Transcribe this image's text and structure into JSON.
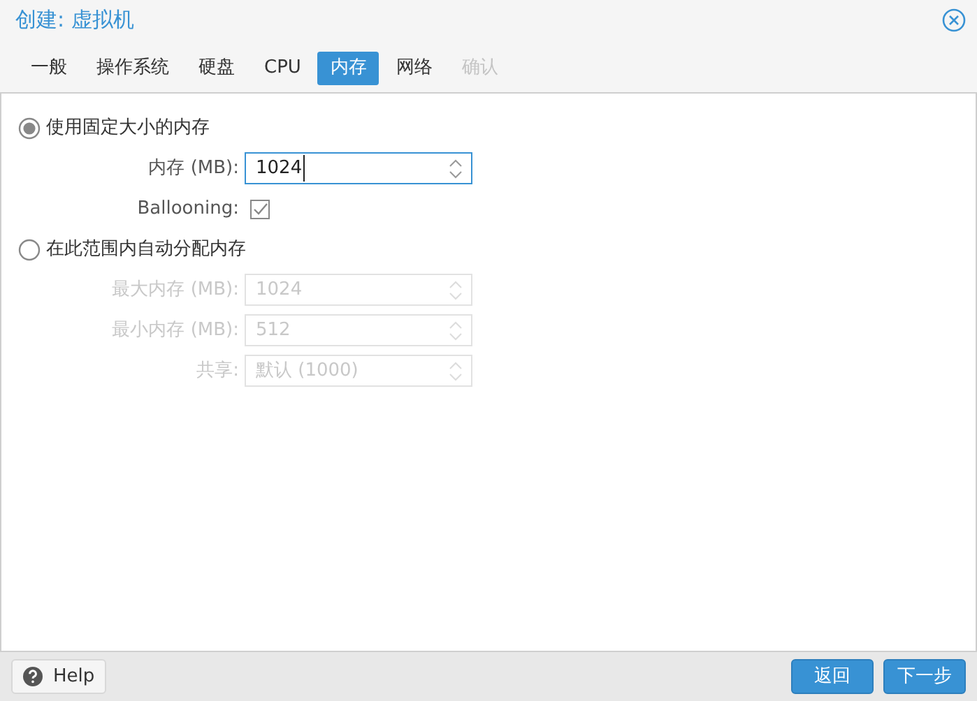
{
  "window": {
    "title": "创建: 虚拟机"
  },
  "tabs": [
    {
      "label": "一般",
      "selected": false,
      "disabled": false
    },
    {
      "label": "操作系统",
      "selected": false,
      "disabled": false
    },
    {
      "label": "硬盘",
      "selected": false,
      "disabled": false
    },
    {
      "label": "CPU",
      "selected": false,
      "disabled": false
    },
    {
      "label": "内存",
      "selected": true,
      "disabled": false
    },
    {
      "label": "网络",
      "selected": false,
      "disabled": false
    },
    {
      "label": "确认",
      "selected": false,
      "disabled": true
    }
  ],
  "options": [
    {
      "label": "使用固定大小的内存",
      "selected": true,
      "fields": [
        {
          "kind": "number",
          "label": "内存 (MB):",
          "value": "1024",
          "disabled": false,
          "focused": true
        },
        {
          "kind": "checkbox",
          "label": "Ballooning:",
          "checked": true,
          "disabled": false
        }
      ]
    },
    {
      "label": "在此范围内自动分配内存",
      "selected": false,
      "fields": [
        {
          "kind": "number",
          "label": "最大内存 (MB):",
          "value": "1024",
          "disabled": true,
          "focused": false
        },
        {
          "kind": "number",
          "label": "最小内存 (MB):",
          "value": "512",
          "disabled": true,
          "focused": false
        },
        {
          "kind": "number",
          "label": "共享:",
          "value": "默认 (1000)",
          "disabled": true,
          "focused": false
        }
      ]
    }
  ],
  "footer": {
    "help": "Help",
    "buttons": [
      "返回",
      "下一步"
    ]
  }
}
